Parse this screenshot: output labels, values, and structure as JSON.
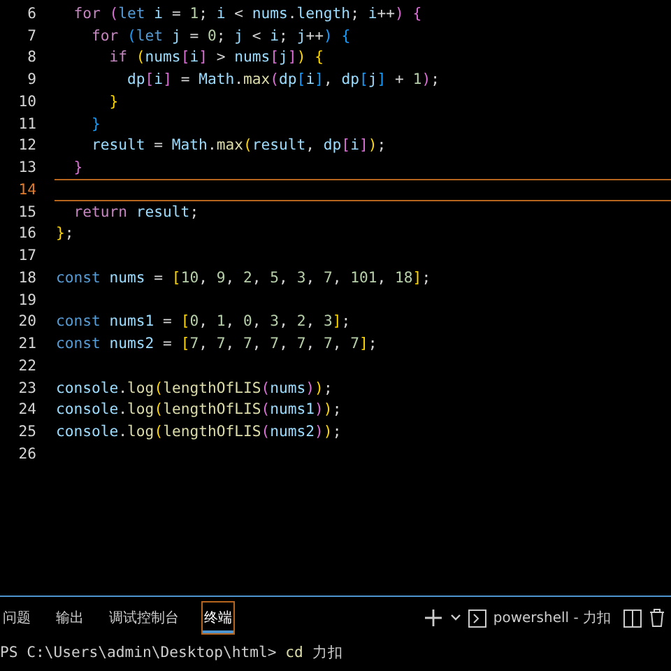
{
  "editor": {
    "lines": [
      {
        "number": "6",
        "current": false,
        "tokens": [
          {
            "kind": "control",
            "text": "  for"
          },
          {
            "kind": "bracket2",
            "text": " ("
          },
          {
            "kind": "declare",
            "text": "let"
          },
          {
            "kind": "variable",
            "text": " i"
          },
          {
            "kind": "operator",
            "text": " = "
          },
          {
            "kind": "number",
            "text": "1"
          },
          {
            "kind": "operator",
            "text": "; "
          },
          {
            "kind": "variable",
            "text": "i"
          },
          {
            "kind": "operator",
            "text": " < "
          },
          {
            "kind": "variable",
            "text": "nums"
          },
          {
            "kind": "operator",
            "text": "."
          },
          {
            "kind": "variable",
            "text": "length"
          },
          {
            "kind": "operator",
            "text": "; "
          },
          {
            "kind": "variable",
            "text": "i"
          },
          {
            "kind": "operator",
            "text": "++"
          },
          {
            "kind": "bracket2",
            "text": ")"
          },
          {
            "kind": "bracket2",
            "text": " {"
          }
        ]
      },
      {
        "number": "7",
        "current": false,
        "tokens": [
          {
            "kind": "control",
            "text": "    for"
          },
          {
            "kind": "bracket3",
            "text": " ("
          },
          {
            "kind": "declare",
            "text": "let"
          },
          {
            "kind": "variable",
            "text": " j"
          },
          {
            "kind": "operator",
            "text": " = "
          },
          {
            "kind": "number",
            "text": "0"
          },
          {
            "kind": "operator",
            "text": "; "
          },
          {
            "kind": "variable",
            "text": "j"
          },
          {
            "kind": "operator",
            "text": " < "
          },
          {
            "kind": "variable",
            "text": "i"
          },
          {
            "kind": "operator",
            "text": "; "
          },
          {
            "kind": "variable",
            "text": "j"
          },
          {
            "kind": "operator",
            "text": "++"
          },
          {
            "kind": "bracket3",
            "text": ")"
          },
          {
            "kind": "bracket3",
            "text": " {"
          }
        ]
      },
      {
        "number": "8",
        "current": false,
        "tokens": [
          {
            "kind": "control",
            "text": "      if"
          },
          {
            "kind": "bracket1",
            "text": " ("
          },
          {
            "kind": "variable",
            "text": "nums"
          },
          {
            "kind": "bracket2",
            "text": "["
          },
          {
            "kind": "variable",
            "text": "i"
          },
          {
            "kind": "bracket2",
            "text": "]"
          },
          {
            "kind": "operator",
            "text": " > "
          },
          {
            "kind": "variable",
            "text": "nums"
          },
          {
            "kind": "bracket2",
            "text": "["
          },
          {
            "kind": "variable",
            "text": "j"
          },
          {
            "kind": "bracket2",
            "text": "]"
          },
          {
            "kind": "bracket1",
            "text": ")"
          },
          {
            "kind": "bracket1",
            "text": " {"
          }
        ]
      },
      {
        "number": "9",
        "current": false,
        "tokens": [
          {
            "kind": "variable",
            "text": "        dp"
          },
          {
            "kind": "bracket2",
            "text": "["
          },
          {
            "kind": "variable",
            "text": "i"
          },
          {
            "kind": "bracket2",
            "text": "]"
          },
          {
            "kind": "operator",
            "text": " = "
          },
          {
            "kind": "variable",
            "text": "Math"
          },
          {
            "kind": "operator",
            "text": "."
          },
          {
            "kind": "function",
            "text": "max"
          },
          {
            "kind": "bracket2",
            "text": "("
          },
          {
            "kind": "variable",
            "text": "dp"
          },
          {
            "kind": "bracket3",
            "text": "["
          },
          {
            "kind": "variable",
            "text": "i"
          },
          {
            "kind": "bracket3",
            "text": "]"
          },
          {
            "kind": "operator",
            "text": ", "
          },
          {
            "kind": "variable",
            "text": "dp"
          },
          {
            "kind": "bracket3",
            "text": "["
          },
          {
            "kind": "variable",
            "text": "j"
          },
          {
            "kind": "bracket3",
            "text": "]"
          },
          {
            "kind": "operator",
            "text": " + "
          },
          {
            "kind": "number",
            "text": "1"
          },
          {
            "kind": "bracket2",
            "text": ")"
          },
          {
            "kind": "operator",
            "text": ";"
          }
        ]
      },
      {
        "number": "10",
        "current": false,
        "tokens": [
          {
            "kind": "bracket1",
            "text": "      }"
          }
        ]
      },
      {
        "number": "11",
        "current": false,
        "tokens": [
          {
            "kind": "bracket3",
            "text": "    }"
          }
        ]
      },
      {
        "number": "12",
        "current": false,
        "tokens": [
          {
            "kind": "variable",
            "text": "    result"
          },
          {
            "kind": "operator",
            "text": " = "
          },
          {
            "kind": "variable",
            "text": "Math"
          },
          {
            "kind": "operator",
            "text": "."
          },
          {
            "kind": "function",
            "text": "max"
          },
          {
            "kind": "bracket1",
            "text": "("
          },
          {
            "kind": "variable",
            "text": "result"
          },
          {
            "kind": "operator",
            "text": ", "
          },
          {
            "kind": "variable",
            "text": "dp"
          },
          {
            "kind": "bracket2",
            "text": "["
          },
          {
            "kind": "variable",
            "text": "i"
          },
          {
            "kind": "bracket2",
            "text": "]"
          },
          {
            "kind": "bracket1",
            "text": ")"
          },
          {
            "kind": "operator",
            "text": ";"
          }
        ]
      },
      {
        "number": "13",
        "current": false,
        "tokens": [
          {
            "kind": "bracket2",
            "text": "  }"
          }
        ]
      },
      {
        "number": "14",
        "current": true
      },
      {
        "number": "15",
        "current": false,
        "tokens": [
          {
            "kind": "control",
            "text": "  return"
          },
          {
            "kind": "variable",
            "text": " result"
          },
          {
            "kind": "operator",
            "text": ";"
          }
        ]
      },
      {
        "number": "16",
        "current": false,
        "tokens": [
          {
            "kind": "bracket1",
            "text": "}"
          },
          {
            "kind": "operator",
            "text": ";"
          }
        ]
      },
      {
        "number": "17",
        "current": false
      },
      {
        "number": "18",
        "current": false,
        "tokens": [
          {
            "kind": "declare",
            "text": "const"
          },
          {
            "kind": "variable",
            "text": " nums"
          },
          {
            "kind": "operator",
            "text": " = "
          },
          {
            "kind": "bracket1",
            "text": "["
          },
          {
            "kind": "number",
            "text": "10"
          },
          {
            "kind": "operator",
            "text": ", "
          },
          {
            "kind": "number",
            "text": "9"
          },
          {
            "kind": "operator",
            "text": ", "
          },
          {
            "kind": "number",
            "text": "2"
          },
          {
            "kind": "operator",
            "text": ", "
          },
          {
            "kind": "number",
            "text": "5"
          },
          {
            "kind": "operator",
            "text": ", "
          },
          {
            "kind": "number",
            "text": "3"
          },
          {
            "kind": "operator",
            "text": ", "
          },
          {
            "kind": "number",
            "text": "7"
          },
          {
            "kind": "operator",
            "text": ", "
          },
          {
            "kind": "number",
            "text": "101"
          },
          {
            "kind": "operator",
            "text": ", "
          },
          {
            "kind": "number",
            "text": "18"
          },
          {
            "kind": "bracket1",
            "text": "]"
          },
          {
            "kind": "operator",
            "text": ";"
          }
        ]
      },
      {
        "number": "19",
        "current": false
      },
      {
        "number": "20",
        "current": false,
        "tokens": [
          {
            "kind": "declare",
            "text": "const"
          },
          {
            "kind": "variable",
            "text": " nums1"
          },
          {
            "kind": "operator",
            "text": " = "
          },
          {
            "kind": "bracket1",
            "text": "["
          },
          {
            "kind": "number",
            "text": "0"
          },
          {
            "kind": "operator",
            "text": ", "
          },
          {
            "kind": "number",
            "text": "1"
          },
          {
            "kind": "operator",
            "text": ", "
          },
          {
            "kind": "number",
            "text": "0"
          },
          {
            "kind": "operator",
            "text": ", "
          },
          {
            "kind": "number",
            "text": "3"
          },
          {
            "kind": "operator",
            "text": ", "
          },
          {
            "kind": "number",
            "text": "2"
          },
          {
            "kind": "operator",
            "text": ", "
          },
          {
            "kind": "number",
            "text": "3"
          },
          {
            "kind": "bracket1",
            "text": "]"
          },
          {
            "kind": "operator",
            "text": ";"
          }
        ]
      },
      {
        "number": "21",
        "current": false,
        "tokens": [
          {
            "kind": "declare",
            "text": "const"
          },
          {
            "kind": "variable",
            "text": " nums2"
          },
          {
            "kind": "operator",
            "text": " = "
          },
          {
            "kind": "bracket1",
            "text": "["
          },
          {
            "kind": "number",
            "text": "7"
          },
          {
            "kind": "operator",
            "text": ", "
          },
          {
            "kind": "number",
            "text": "7"
          },
          {
            "kind": "operator",
            "text": ", "
          },
          {
            "kind": "number",
            "text": "7"
          },
          {
            "kind": "operator",
            "text": ", "
          },
          {
            "kind": "number",
            "text": "7"
          },
          {
            "kind": "operator",
            "text": ", "
          },
          {
            "kind": "number",
            "text": "7"
          },
          {
            "kind": "operator",
            "text": ", "
          },
          {
            "kind": "number",
            "text": "7"
          },
          {
            "kind": "operator",
            "text": ", "
          },
          {
            "kind": "number",
            "text": "7"
          },
          {
            "kind": "bracket1",
            "text": "]"
          },
          {
            "kind": "operator",
            "text": ";"
          }
        ]
      },
      {
        "number": "22",
        "current": false
      },
      {
        "number": "23",
        "current": false,
        "tokens": [
          {
            "kind": "variable",
            "text": "console"
          },
          {
            "kind": "operator",
            "text": "."
          },
          {
            "kind": "function",
            "text": "log"
          },
          {
            "kind": "bracket1",
            "text": "("
          },
          {
            "kind": "function",
            "text": "lengthOfLIS"
          },
          {
            "kind": "bracket2",
            "text": "("
          },
          {
            "kind": "variable",
            "text": "nums"
          },
          {
            "kind": "bracket2",
            "text": ")"
          },
          {
            "kind": "bracket1",
            "text": ")"
          },
          {
            "kind": "operator",
            "text": ";"
          }
        ]
      },
      {
        "number": "24",
        "current": false,
        "tokens": [
          {
            "kind": "variable",
            "text": "console"
          },
          {
            "kind": "operator",
            "text": "."
          },
          {
            "kind": "function",
            "text": "log"
          },
          {
            "kind": "bracket1",
            "text": "("
          },
          {
            "kind": "function",
            "text": "lengthOfLIS"
          },
          {
            "kind": "bracket2",
            "text": "("
          },
          {
            "kind": "variable",
            "text": "nums1"
          },
          {
            "kind": "bracket2",
            "text": ")"
          },
          {
            "kind": "bracket1",
            "text": ")"
          },
          {
            "kind": "operator",
            "text": ";"
          }
        ]
      },
      {
        "number": "25",
        "current": false,
        "tokens": [
          {
            "kind": "variable",
            "text": "console"
          },
          {
            "kind": "operator",
            "text": "."
          },
          {
            "kind": "function",
            "text": "log"
          },
          {
            "kind": "bracket1",
            "text": "("
          },
          {
            "kind": "function",
            "text": "lengthOfLIS"
          },
          {
            "kind": "bracket2",
            "text": "("
          },
          {
            "kind": "variable",
            "text": "nums2"
          },
          {
            "kind": "bracket2",
            "text": ")"
          },
          {
            "kind": "bracket1",
            "text": ")"
          },
          {
            "kind": "operator",
            "text": ";"
          }
        ]
      },
      {
        "number": "26",
        "current": false
      }
    ]
  },
  "panel": {
    "tabs": [
      {
        "label": "问题",
        "selected": false
      },
      {
        "label": "输出",
        "selected": false
      },
      {
        "label": "调试控制台",
        "selected": false
      },
      {
        "label": "终端",
        "selected": true
      }
    ],
    "terminal_name": "powershell - 力扣",
    "terminal": {
      "prompt": "PS C:\\Users\\admin\\Desktop\\html>",
      "command": "cd",
      "argument": "力扣"
    }
  }
}
